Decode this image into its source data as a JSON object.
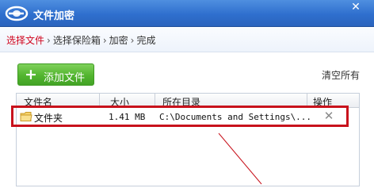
{
  "window": {
    "title": "文件加密",
    "close_glyph": "✕"
  },
  "steps": {
    "items": [
      "选择文件",
      "选择保险箱",
      "加密",
      "完成"
    ],
    "separator": "›",
    "active_index": 0
  },
  "toolbar": {
    "add_label": "添加文件",
    "clear_label": "清空所有"
  },
  "table": {
    "columns": [
      "文件名",
      "大小",
      "所在目录",
      "操作"
    ],
    "rows": [
      {
        "name": "文件夹",
        "size": "1.41 MB",
        "dir": "C:\\Documents and Settings\\..."
      }
    ]
  },
  "icons": {
    "app_logo": "app-logo-icon",
    "folder": "folder-icon",
    "delete": "delete-icon",
    "plus": "plus-icon"
  },
  "colors": {
    "titlebar": "#2f6fce",
    "active_step": "#d0021b",
    "add_button": "#52b52e",
    "highlight": "#c8121c"
  }
}
